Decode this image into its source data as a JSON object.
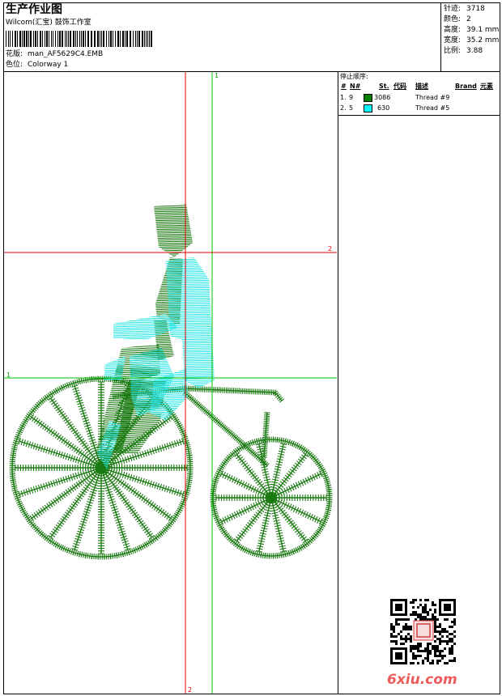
{
  "header": {
    "title": "生产作业图",
    "company": "Wilcom(汇宝) 鼓饰工作室",
    "design_label": "花版:",
    "design_file": "man_AF5629C4.EMB",
    "colorway_label": "色位:",
    "colorway": "Colorway 1"
  },
  "stats": [
    {
      "label": "针迹:",
      "value": "3718"
    },
    {
      "label": "颜色:",
      "value": "2"
    },
    {
      "label": "高度:",
      "value": "39.1 mm"
    },
    {
      "label": "宽度:",
      "value": "35.2 mm"
    },
    {
      "label": "比例:",
      "value": "3.88"
    }
  ],
  "stop_sequence": {
    "title": "停止顺序:",
    "columns": [
      "#",
      "N#",
      "St.",
      "代码",
      "描述",
      "Brand",
      "元素"
    ],
    "rows": [
      {
        "index": "1.",
        "n": "9",
        "color": "#008000",
        "stitches": "3086",
        "desc": "Thread #9"
      },
      {
        "index": "2.",
        "n": "5",
        "color": "#00ffff",
        "stitches": "630",
        "desc": "Thread #5"
      }
    ]
  },
  "axis_labels": {
    "top_green": "1",
    "right_red": "2",
    "left_green": "1",
    "bottom_red": "2"
  },
  "colors": {
    "thread_green": "#1b7a12",
    "thread_cyan": "#2ee6e6",
    "red_axis": "#e00000",
    "green_axis": "#00c000"
  },
  "watermark": "6xiu.com"
}
